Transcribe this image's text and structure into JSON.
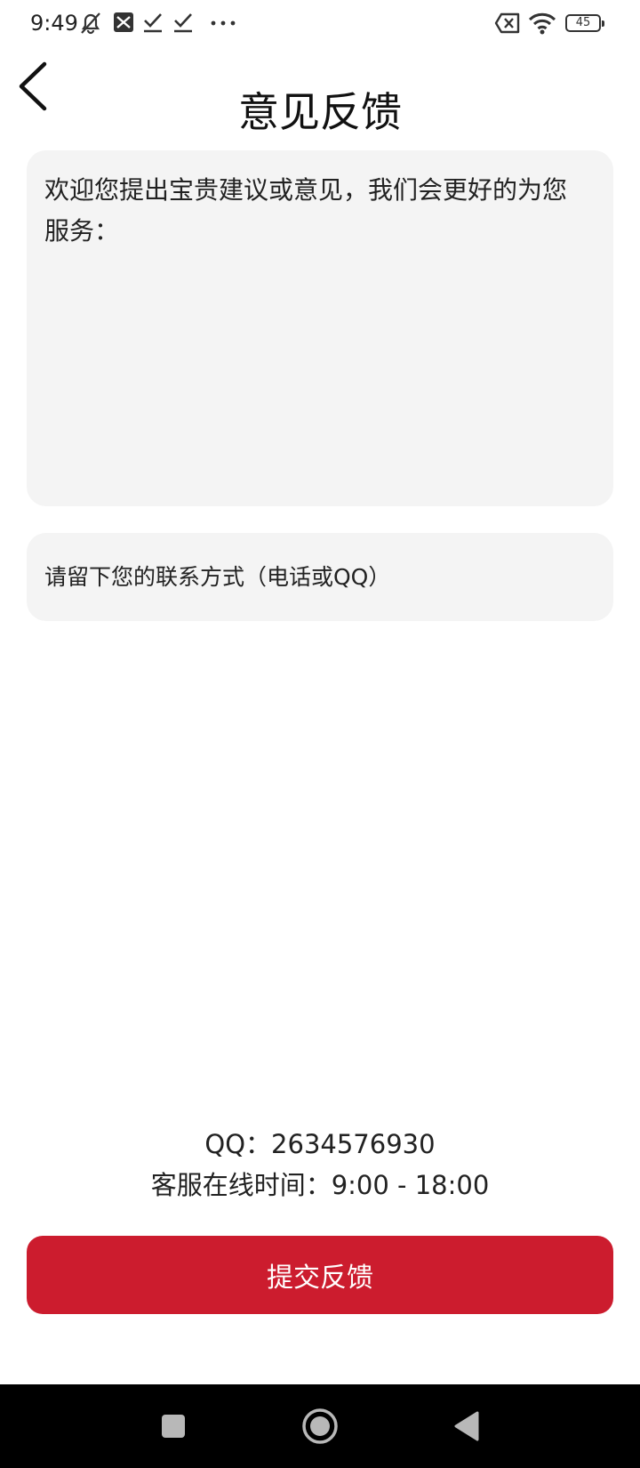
{
  "status_bar": {
    "time": "9:49",
    "battery": "45",
    "icons": [
      "muted-bell-icon",
      "app-notification-icon",
      "check-icon",
      "check-icon",
      "more-icon",
      "no-sim-icon",
      "wifi-icon",
      "battery-icon"
    ]
  },
  "header": {
    "title": "意见反馈",
    "back_icon": "chevron-left-icon"
  },
  "form": {
    "feedback_placeholder": "欢迎您提出宝贵建议或意见，我们会更好的为您 服务：",
    "feedback_value": "",
    "contact_placeholder": "请留下您的联系方式（电话或QQ）",
    "contact_value": ""
  },
  "info": {
    "qq": "QQ：2634576930",
    "service_hours": "客服在线时间：9:00 - 18:00"
  },
  "submit": {
    "label": "提交反馈"
  },
  "colors": {
    "accent": "#cc1c2e",
    "input_bg": "#f4f4f4",
    "nav_bar_bg": "#000000"
  },
  "nav_bar": {
    "icons": [
      "recent-apps-icon",
      "home-icon",
      "back-icon"
    ]
  }
}
